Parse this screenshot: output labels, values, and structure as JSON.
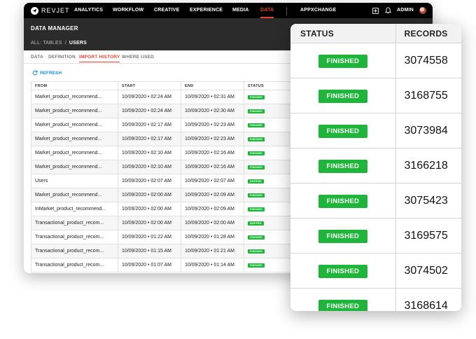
{
  "brand": {
    "name": "REVJET",
    "accent": "#e8442f",
    "link": "#1a8fd8",
    "success": "#1eb53a"
  },
  "nav": {
    "items": [
      "ANALYTICS",
      "WORKFLOW",
      "CREATIVE",
      "EXPERIENCE",
      "MEDIA",
      "DATA",
      "APPXCHANGE"
    ],
    "active": "DATA",
    "user": "ADMIN",
    "icons": [
      "add-box-icon",
      "bell-icon",
      "avatar"
    ]
  },
  "header": {
    "title": "DATA MANAGER",
    "breadcrumb": {
      "parent": "ALL: TABLES",
      "separator": "/",
      "current": "USERS"
    }
  },
  "tabs": [
    "DATA",
    "DEFINITION",
    "IMPORT HISTORY",
    "WHERE USED"
  ],
  "active_tab": "IMPORT HISTORY",
  "refresh_label": "REFRESH",
  "table": {
    "columns": [
      "FROM",
      "START",
      "END",
      "STATUS"
    ],
    "rows": [
      {
        "from": "Market_product_recommend...",
        "start": "10/09/2020 • 02:24 AM",
        "end": "10/09/2020 • 02:31 AM",
        "status": "FINISHED"
      },
      {
        "from": "Market_product_recommend...",
        "start": "10/09/2020 • 02:24 AM",
        "end": "10/09/2020 • 02:30 AM",
        "status": "FINISHED"
      },
      {
        "from": "Market_product_recommend...",
        "start": "10/09/2020 • 02:17 AM",
        "end": "10/09/2020 • 02:23 AM",
        "status": "FINISHED"
      },
      {
        "from": "Market_product_recommend...",
        "start": "10/09/2020 • 02:17 AM",
        "end": "10/09/2020 • 02:23 AM",
        "status": "FINISHED"
      },
      {
        "from": "Market_product_recommend...",
        "start": "10/09/2020 • 02:10 AM",
        "end": "10/09/2020 • 02:16 AM",
        "status": "FINISHED"
      },
      {
        "from": "Market_product_recommend...",
        "start": "10/09/2020 • 02:10 AM",
        "end": "10/09/2020 • 02:16 AM",
        "status": "FINISHED"
      },
      {
        "from": "Users",
        "start": "10/09/2020 • 02:07 AM",
        "end": "10/09/2020 • 02:07 AM",
        "status": "SKIPPED"
      },
      {
        "from": "Market_product_recommend...",
        "start": "10/09/2020 • 02:00 AM",
        "end": "10/09/2020 • 02:09 AM",
        "status": "FINISHED"
      },
      {
        "from": "InMarket_product_recommend...",
        "start": "10/09/2020 • 02:00 AM",
        "end": "10/09/2020 • 02:09 AM",
        "status": "FINISHED"
      },
      {
        "from": "Transactional_product_recom...",
        "start": "10/09/2020 • 02:00 AM",
        "end": "10/09/2020 • 02:00 AM",
        "status": "SKIPPED"
      },
      {
        "from": "Transactional_product_recom...",
        "start": "10/09/2020 • 01:22 AM",
        "end": "10/09/2020 • 01:28 AM",
        "status": "FINISHED"
      },
      {
        "from": "Transactional_product_recom...",
        "start": "10/09/2020 • 01:15 AM",
        "end": "10/09/2020 • 01:21 AM",
        "status": "FINISHED"
      },
      {
        "from": "Transactional_product_recom...",
        "start": "10/09/2020 • 01:07 AM",
        "end": "10/09/2020 • 01:14 AM",
        "status": "FINISHED"
      }
    ]
  },
  "zoom": {
    "columns": [
      "STATUS",
      "RECORDS"
    ],
    "rows": [
      {
        "status": "FINISHED",
        "records": "3074558"
      },
      {
        "status": "FINISHED",
        "records": "3168755"
      },
      {
        "status": "FINISHED",
        "records": "3073984"
      },
      {
        "status": "FINISHED",
        "records": "3166218"
      },
      {
        "status": "FINISHED",
        "records": "3075423"
      },
      {
        "status": "FINISHED",
        "records": "3169575"
      },
      {
        "status": "FINISHED",
        "records": "3074502"
      },
      {
        "status": "FINISHED",
        "records": "3168614"
      }
    ]
  }
}
